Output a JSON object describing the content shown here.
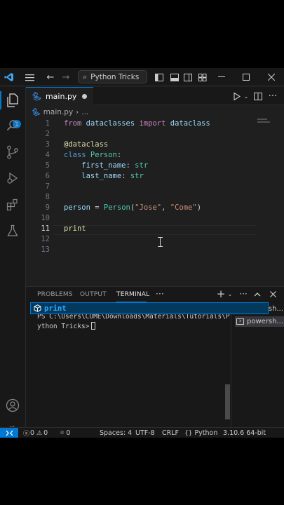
{
  "window": {
    "search_label": "Python Tricks"
  },
  "tabs": [
    {
      "label": "main.py",
      "modified": true
    }
  ],
  "breadcrumb": {
    "file": "main.py",
    "more": "..."
  },
  "editor": {
    "lines": [
      {
        "n": "1",
        "tokens": [
          {
            "t": "from",
            "c": "kw"
          },
          {
            "t": " dataclasses ",
            "c": "var"
          },
          {
            "t": "import",
            "c": "kw"
          },
          {
            "t": " dataclass",
            "c": "var"
          }
        ]
      },
      {
        "n": "2",
        "tokens": []
      },
      {
        "n": "3",
        "tokens": [
          {
            "t": "@dataclass",
            "c": "dec"
          }
        ]
      },
      {
        "n": "4",
        "tokens": [
          {
            "t": "class",
            "c": "kw2"
          },
          {
            "t": " Person",
            "c": "cls"
          },
          {
            "t": ":",
            "c": "dflt"
          }
        ]
      },
      {
        "n": "5",
        "tokens": [
          {
            "t": "    first_name",
            "c": "var"
          },
          {
            "t": ": ",
            "c": "dflt"
          },
          {
            "t": "str",
            "c": "cls"
          }
        ]
      },
      {
        "n": "6",
        "tokens": [
          {
            "t": "    last_name",
            "c": "var"
          },
          {
            "t": ": ",
            "c": "dflt"
          },
          {
            "t": "str",
            "c": "cls"
          }
        ]
      },
      {
        "n": "7",
        "tokens": []
      },
      {
        "n": "8",
        "tokens": []
      },
      {
        "n": "9",
        "tokens": [
          {
            "t": "person",
            "c": "var"
          },
          {
            "t": " = ",
            "c": "dflt"
          },
          {
            "t": "Person",
            "c": "cls"
          },
          {
            "t": "(",
            "c": "dflt"
          },
          {
            "t": "\"Jose\"",
            "c": "str"
          },
          {
            "t": ", ",
            "c": "dflt"
          },
          {
            "t": "\"Come\"",
            "c": "str"
          },
          {
            "t": ")",
            "c": "dflt"
          }
        ]
      },
      {
        "n": "10",
        "tokens": []
      },
      {
        "n": "11",
        "tokens": [
          {
            "t": "print",
            "c": "fn"
          }
        ],
        "current": true
      },
      {
        "n": "12",
        "tokens": []
      },
      {
        "n": "13",
        "tokens": []
      }
    ]
  },
  "suggest": {
    "label": "print",
    "icon": "cube-icon"
  },
  "panel": {
    "tabs": [
      "PROBLEMS",
      "OUTPUT",
      "TERMINAL"
    ],
    "active_tab": "TERMINAL",
    "more": "···",
    "terminal_prompt": "PS C:\\Users\\COME\\Downloads\\Materials\\Tutorials\\Python Tricks>",
    "terminals": [
      "powersh...",
      "powersh..."
    ]
  },
  "statusbar": {
    "errors": "0",
    "warnings": "0",
    "ports": "0",
    "spaces": "Spaces: 4",
    "encoding": "UTF-8",
    "eol": "CRLF",
    "language": "Python",
    "interpreter": "3.10.6 64-bit"
  },
  "colors": {
    "accent": "#0078d4",
    "background": "#1f1f1f",
    "chrome": "#181818"
  }
}
